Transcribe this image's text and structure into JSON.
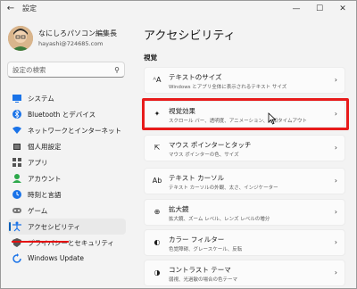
{
  "window": {
    "title": "設定",
    "back_icon": "back-arrow-icon",
    "controls": {
      "minimize": "—",
      "maximize": "☐",
      "close": "✕"
    }
  },
  "user": {
    "name": "なにしろパソコン編集長",
    "email": "hayashi@724685.com"
  },
  "search": {
    "placeholder": "設定の検索"
  },
  "sidebar": {
    "items": [
      {
        "label": "システム",
        "icon": "system-icon",
        "active": false
      },
      {
        "label": "Bluetooth とデバイス",
        "icon": "bluetooth-icon",
        "active": false
      },
      {
        "label": "ネットワークとインターネット",
        "icon": "network-icon",
        "active": false
      },
      {
        "label": "個人用設定",
        "icon": "brush-icon",
        "active": false
      },
      {
        "label": "アプリ",
        "icon": "apps-icon",
        "active": false
      },
      {
        "label": "アカウント",
        "icon": "account-icon",
        "active": false
      },
      {
        "label": "時刻と言語",
        "icon": "clock-globe-icon",
        "active": false
      },
      {
        "label": "ゲーム",
        "icon": "gamepad-icon",
        "active": false
      },
      {
        "label": "アクセシビリティ",
        "icon": "accessibility-icon",
        "active": true
      },
      {
        "label": "プライバシーとセキュリティ",
        "icon": "shield-icon",
        "active": false
      },
      {
        "label": "Windows Update",
        "icon": "update-icon",
        "active": false
      }
    ]
  },
  "main": {
    "title": "アクセシビリティ",
    "section": "視覚",
    "cards": [
      {
        "title": "テキストのサイズ",
        "desc": "Windows とアプリ全体に表示されるテキスト サイズ",
        "icon": "text-size-icon"
      },
      {
        "title": "視覚効果",
        "desc": "スクロール バー、透明度、アニメーション、通知タイムアウト",
        "icon": "sparkle-icon",
        "highlighted": true
      },
      {
        "title": "マウス ポインターとタッチ",
        "desc": "マウス ポインターの色、サイズ",
        "icon": "mouse-pointer-icon"
      },
      {
        "title": "テキスト カーソル",
        "desc": "テキスト カーソルの外観、太さ、インジケーター",
        "icon": "text-cursor-icon"
      },
      {
        "title": "拡大鏡",
        "desc": "拡大鏡、ズーム レベル、レンズ レベルの増分",
        "icon": "magnifier-icon"
      },
      {
        "title": "カラー フィルター",
        "desc": "色覚障碍、グレースケール、反転",
        "icon": "color-filter-icon"
      },
      {
        "title": "コントラスト テーマ",
        "desc": "弱視、光過敏の場合の色テーマ",
        "icon": "contrast-icon"
      }
    ]
  },
  "colors": {
    "accent": "#005fb8",
    "highlight_red": "#e81b1b"
  }
}
